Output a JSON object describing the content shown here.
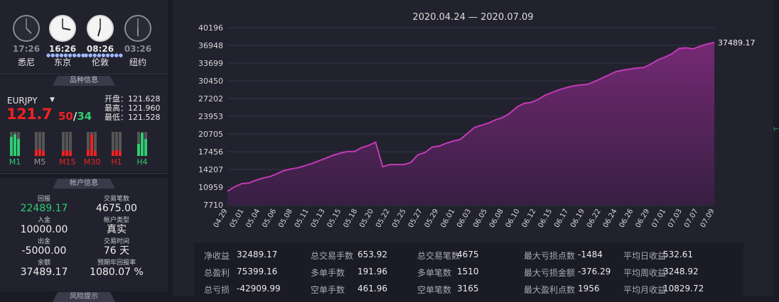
{
  "clocks": [
    {
      "time": "17:26",
      "city": "悉尼",
      "active": false
    },
    {
      "time": "16:26",
      "city": "东京",
      "active": true
    },
    {
      "time": "08:26",
      "city": "伦敦",
      "active": true
    },
    {
      "time": "03:26",
      "city": "纽约",
      "active": false
    }
  ],
  "symbol_section": {
    "title": "品种信息",
    "symbol": "EURJPY",
    "price_main": "121.7",
    "price_tail_a": "50",
    "price_sep": "/",
    "price_tail_b": "34",
    "open": "开盘：121.628",
    "high": "最高：121.960",
    "low": "最低：121.528",
    "timeframes": [
      "M1",
      "M5",
      "M15",
      "M30",
      "H1",
      "H4"
    ]
  },
  "account_section": {
    "title": "帐户信息",
    "items": [
      {
        "label": "回报",
        "value": "22489.17",
        "color": "#2ecc71"
      },
      {
        "label": "交易笔数",
        "value": "4675.00"
      },
      {
        "label": "入金",
        "value": "10000.00"
      },
      {
        "label": "帐户类型",
        "value": "真实"
      },
      {
        "label": "出金",
        "value": "-5000.00"
      },
      {
        "label": "交易时间",
        "value": "76 天"
      },
      {
        "label": "余额",
        "value": "37489.17"
      },
      {
        "label": "预期年回报率",
        "value": "1080.07 %"
      }
    ],
    "next_title": "风险提示"
  },
  "chart_data": {
    "type": "area",
    "title": "2020.04.24 — 2020.07.09",
    "y_ticks": [
      "40196",
      "36948",
      "33699",
      "30450",
      "27202",
      "23953",
      "20705",
      "17456",
      "14207",
      "10959",
      "7710"
    ],
    "ylim": [
      7710,
      40196
    ],
    "x_labels": [
      "04.29",
      "05.01",
      "05.04",
      "05.06",
      "05.08",
      "05.11",
      "05.13",
      "05.15",
      "05.18",
      "05.20",
      "05.22",
      "05.25",
      "05.27",
      "05.29",
      "06.01",
      "06.03",
      "06.05",
      "06.08",
      "06.10",
      "06.12",
      "06.15",
      "06.17",
      "06.19",
      "06.22",
      "06.24",
      "06.26",
      "06.29",
      "07.01",
      "07.03",
      "07.07",
      "07.09"
    ],
    "last_value_label": "37489.17",
    "values": [
      10200,
      11000,
      11600,
      11700,
      12200,
      12600,
      12900,
      13400,
      14000,
      14300,
      14500,
      14900,
      15300,
      15800,
      16300,
      16800,
      17200,
      17500,
      17500,
      18200,
      18600,
      19200,
      14700,
      15100,
      15100,
      15100,
      15500,
      16900,
      17300,
      18300,
      18500,
      19000,
      19400,
      19700,
      20800,
      21900,
      22300,
      22700,
      23300,
      23700,
      24500,
      25600,
      26300,
      26500,
      27000,
      27800,
      28300,
      28800,
      29200,
      29500,
      29700,
      29800,
      30300,
      30900,
      31500,
      32100,
      32400,
      32600,
      32800,
      32900,
      33500,
      34300,
      34800,
      35400,
      36400,
      36500,
      36300,
      36800,
      37200,
      37489.17
    ]
  },
  "summary": [
    {
      "k": "净收益",
      "v": "32489.17"
    },
    {
      "k": "总交易手数",
      "v": "653.92"
    },
    {
      "k": "总交易笔数",
      "v": "4675"
    },
    {
      "k": "最大亏损点数",
      "v": "-1484"
    },
    {
      "k": "平均日收益",
      "v": "532.61"
    },
    {
      "k": "总盈利",
      "v": "75399.16"
    },
    {
      "k": "多单手数",
      "v": "191.96"
    },
    {
      "k": "多单笔数",
      "v": "1510"
    },
    {
      "k": "最大亏损金额",
      "v": "-376.29"
    },
    {
      "k": "平均周收益",
      "v": "3248.92"
    },
    {
      "k": "总亏损",
      "v": "-42909.99"
    },
    {
      "k": "空单手数",
      "v": "461.96"
    },
    {
      "k": "空单笔数",
      "v": "3165"
    },
    {
      "k": "最大盈利点数",
      "v": "1956"
    },
    {
      "k": "平均月收益",
      "v": "10829.72"
    }
  ],
  "colors": {
    "line": "#c23bb5",
    "green": "#2ecc71",
    "red": "#ee2222"
  }
}
